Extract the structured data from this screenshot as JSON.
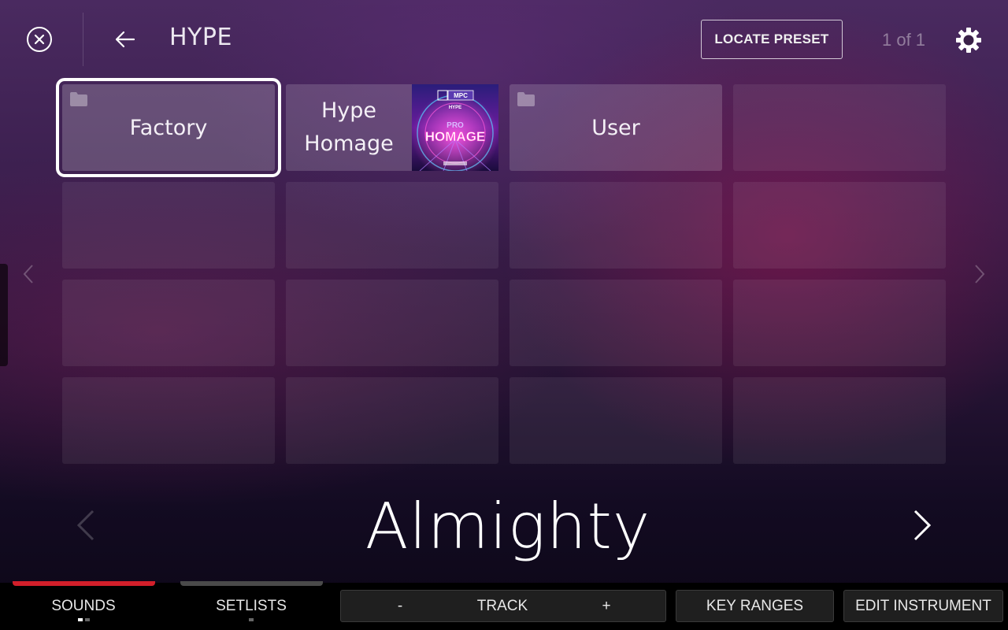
{
  "header": {
    "title": "HYPE",
    "locate_label": "LOCATE PRESET",
    "page_indicator": "1 of 1"
  },
  "grid": {
    "factory_label": "Factory",
    "hype_line1": "Hype",
    "hype_line2": "Homage",
    "user_label": "User",
    "album_art": {
      "brand": "MPC",
      "tag": "HYPE",
      "line1": "PRO",
      "line2": "HOMAGE"
    }
  },
  "preset": {
    "name": "Almighty"
  },
  "footer": {
    "sounds_label": "SOUNDS",
    "setlists_label": "SETLISTS",
    "track_minus": "-",
    "track_label": "TRACK",
    "track_plus": "+",
    "key_ranges_label": "KEY RANGES",
    "edit_instrument_label": "EDIT INSTRUMENT"
  },
  "colors": {
    "active_tab": "#d21f2a",
    "inactive_tab": "#4a4a4a",
    "selection": "#ffffff"
  }
}
